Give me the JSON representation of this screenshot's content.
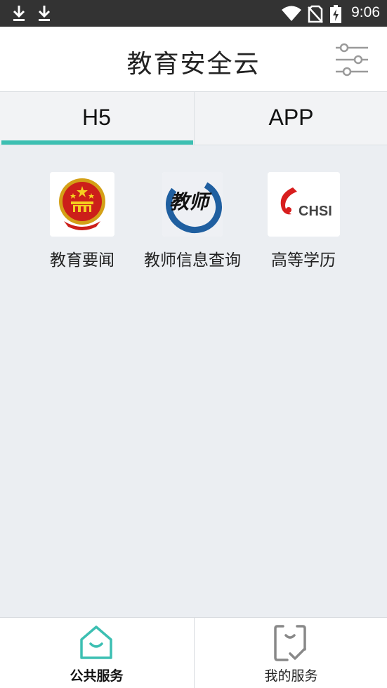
{
  "status_bar": {
    "time": "9:06",
    "icons": [
      "download-icon",
      "download-icon",
      "wifi-icon",
      "no-sim-icon",
      "battery-charging-icon"
    ]
  },
  "header": {
    "title": "教育安全云",
    "filter_icon": "sliders-icon"
  },
  "tabs": [
    {
      "label": "H5",
      "active": true
    },
    {
      "label": "APP",
      "active": false
    }
  ],
  "accent_color": "#3cbfb2",
  "services": [
    {
      "label": "教育要闻",
      "icon": "national-emblem-icon"
    },
    {
      "label": "教师信息查询",
      "icon": "teacher-calligraphy-icon",
      "icon_text": "教师"
    },
    {
      "label": "高等学历",
      "icon": "chsi-logo-icon",
      "icon_text": "CHSI"
    }
  ],
  "bottom_nav": [
    {
      "label": "公共服务",
      "icon": "home-icon",
      "active": true
    },
    {
      "label": "我的服务",
      "icon": "checklist-icon",
      "active": false
    }
  ]
}
